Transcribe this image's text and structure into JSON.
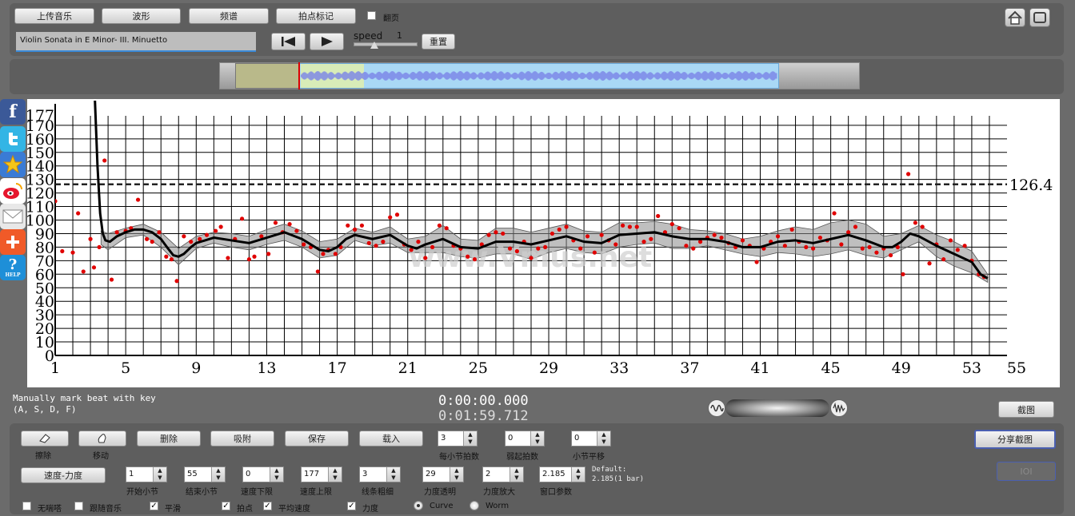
{
  "toolbar": {
    "upload_label": "上传音乐",
    "waveform_label": "波形",
    "spectrum_label": "频谱",
    "beat_mark_label": "拍点标记",
    "page_flip_label": "翻页",
    "page_flip_checked": false
  },
  "track": {
    "title": "Violin Sonata in E Minor- III. Minuetto",
    "speed_label": "speed",
    "speed_value": "1",
    "reset_label": "重置"
  },
  "social": {
    "facebook": "f",
    "help": "HELP"
  },
  "chart_data": {
    "type": "scatter",
    "xlim": [
      1,
      55
    ],
    "ylim": [
      0,
      177
    ],
    "xticks": [
      "1",
      "5",
      "9",
      "13",
      "17",
      "21",
      "25",
      "29",
      "33",
      "37",
      "41",
      "45",
      "49",
      "53",
      "55"
    ],
    "yticks": [
      "0",
      "10",
      "20",
      "30",
      "40",
      "50",
      "60",
      "70",
      "80",
      "90",
      "100",
      "110",
      "120",
      "130",
      "140",
      "150",
      "160",
      "170",
      "177"
    ],
    "average_label": "126.4",
    "average_value": 126.4,
    "watermark": "www.Vmus.net",
    "curve": [
      [
        3.25,
        190
      ],
      [
        3.4,
        140
      ],
      [
        3.55,
        105
      ],
      [
        3.7,
        90
      ],
      [
        3.85,
        85
      ],
      [
        4.1,
        84
      ],
      [
        4.5,
        88
      ],
      [
        5,
        91
      ],
      [
        5.5,
        93
      ],
      [
        6,
        93
      ],
      [
        6.5,
        91
      ],
      [
        7,
        86
      ],
      [
        7.4,
        79
      ],
      [
        7.7,
        74
      ],
      [
        8,
        73
      ],
      [
        8.3,
        75
      ],
      [
        8.7,
        80
      ],
      [
        9,
        83
      ],
      [
        10,
        87
      ],
      [
        11,
        85
      ],
      [
        12,
        83
      ],
      [
        13,
        87
      ],
      [
        14,
        91
      ],
      [
        15,
        86
      ],
      [
        16,
        78
      ],
      [
        16.5,
        77
      ],
      [
        17,
        80
      ],
      [
        17.5,
        86
      ],
      [
        18,
        89
      ],
      [
        19,
        86
      ],
      [
        20,
        89
      ],
      [
        21,
        81
      ],
      [
        21.5,
        79
      ],
      [
        22,
        82
      ],
      [
        23,
        86
      ],
      [
        24,
        80
      ],
      [
        25,
        79
      ],
      [
        26,
        84
      ],
      [
        27,
        84
      ],
      [
        28,
        82
      ],
      [
        29,
        85
      ],
      [
        30,
        88
      ],
      [
        31,
        84
      ],
      [
        32,
        83
      ],
      [
        33,
        89
      ],
      [
        34,
        90
      ],
      [
        35,
        91
      ],
      [
        36,
        88
      ],
      [
        37,
        86
      ],
      [
        38,
        86
      ],
      [
        39,
        84
      ],
      [
        40,
        80
      ],
      [
        41,
        80
      ],
      [
        42,
        84
      ],
      [
        43,
        85
      ],
      [
        44,
        83
      ],
      [
        45,
        86
      ],
      [
        46,
        89
      ],
      [
        47,
        85
      ],
      [
        48,
        80
      ],
      [
        48.5,
        80
      ],
      [
        49,
        84
      ],
      [
        49.5,
        90
      ],
      [
        50,
        88
      ],
      [
        51,
        81
      ],
      [
        52,
        75
      ],
      [
        53,
        69
      ],
      [
        53.5,
        60
      ],
      [
        53.9,
        57
      ]
    ],
    "band": [
      [
        3.6,
        92,
        82
      ],
      [
        4,
        90,
        78
      ],
      [
        5,
        94,
        87
      ],
      [
        6,
        97,
        89
      ],
      [
        7,
        91,
        80
      ],
      [
        8,
        79,
        67
      ],
      [
        9,
        88,
        79
      ],
      [
        10,
        91,
        83
      ],
      [
        11,
        90,
        80
      ],
      [
        12,
        88,
        78
      ],
      [
        13,
        93,
        82
      ],
      [
        14,
        97,
        85
      ],
      [
        15,
        92,
        80
      ],
      [
        16,
        84,
        72
      ],
      [
        17,
        86,
        74
      ],
      [
        18,
        94,
        85
      ],
      [
        19,
        91,
        81
      ],
      [
        20,
        95,
        83
      ],
      [
        21,
        86,
        76
      ],
      [
        22,
        88,
        76
      ],
      [
        23,
        96,
        76
      ],
      [
        24,
        86,
        73
      ],
      [
        25,
        85,
        72
      ],
      [
        26,
        94,
        75
      ],
      [
        27,
        94,
        75
      ],
      [
        28,
        91,
        71
      ],
      [
        29,
        94,
        76
      ],
      [
        30,
        97,
        79
      ],
      [
        31,
        92,
        76
      ],
      [
        32,
        91,
        75
      ],
      [
        33,
        98,
        80
      ],
      [
        34,
        98,
        82
      ],
      [
        35,
        99,
        83
      ],
      [
        36,
        97,
        79
      ],
      [
        37,
        93,
        79
      ],
      [
        38,
        92,
        81
      ],
      [
        39,
        90,
        78
      ],
      [
        40,
        86,
        75
      ],
      [
        41,
        88,
        73
      ],
      [
        42,
        92,
        76
      ],
      [
        43,
        95,
        75
      ],
      [
        44,
        93,
        73
      ],
      [
        45,
        98,
        75
      ],
      [
        46,
        100,
        78
      ],
      [
        47,
        97,
        74
      ],
      [
        48,
        88,
        72
      ],
      [
        49,
        90,
        78
      ],
      [
        50,
        96,
        84
      ],
      [
        51,
        89,
        73
      ],
      [
        52,
        84,
        66
      ],
      [
        53,
        77,
        61
      ],
      [
        53.9,
        60,
        54
      ]
    ],
    "points": [
      [
        1,
        114
      ],
      [
        1.4,
        77
      ],
      [
        2,
        76
      ],
      [
        2.3,
        105
      ],
      [
        2.6,
        62
      ],
      [
        3,
        86
      ],
      [
        3.2,
        65
      ],
      [
        3.5,
        80
      ],
      [
        3.8,
        144
      ],
      [
        4.2,
        56
      ],
      [
        4.5,
        91
      ],
      [
        5,
        92
      ],
      [
        5.3,
        94
      ],
      [
        5.7,
        115
      ],
      [
        6.2,
        86
      ],
      [
        6.5,
        84
      ],
      [
        6.9,
        91
      ],
      [
        7.3,
        73
      ],
      [
        7.6,
        71
      ],
      [
        7.9,
        55
      ],
      [
        8.3,
        88
      ],
      [
        8.7,
        84
      ],
      [
        9.2,
        86
      ],
      [
        9.6,
        89
      ],
      [
        10.1,
        92
      ],
      [
        10.4,
        95
      ],
      [
        10.8,
        72
      ],
      [
        11.2,
        86
      ],
      [
        11.6,
        101
      ],
      [
        12,
        71
      ],
      [
        12.3,
        73
      ],
      [
        12.7,
        88
      ],
      [
        13.1,
        75
      ],
      [
        13.5,
        98
      ],
      [
        13.9,
        91
      ],
      [
        14.3,
        97
      ],
      [
        14.7,
        92
      ],
      [
        15.1,
        82
      ],
      [
        15.5,
        80
      ],
      [
        15.9,
        62
      ],
      [
        16.2,
        75
      ],
      [
        16.5,
        78
      ],
      [
        16.9,
        75
      ],
      [
        17.2,
        80
      ],
      [
        17.6,
        96
      ],
      [
        18,
        93
      ],
      [
        18.4,
        96
      ],
      [
        18.8,
        83
      ],
      [
        19.2,
        81
      ],
      [
        19.6,
        84
      ],
      [
        20,
        102
      ],
      [
        20.4,
        104
      ],
      [
        20.8,
        82
      ],
      [
        21.2,
        78
      ],
      [
        21.6,
        84
      ],
      [
        22,
        72
      ],
      [
        22.4,
        80
      ],
      [
        22.8,
        96
      ],
      [
        23.2,
        94
      ],
      [
        23.6,
        81
      ],
      [
        24,
        79
      ],
      [
        24.4,
        73
      ],
      [
        24.8,
        71
      ],
      [
        25.2,
        82
      ],
      [
        25.6,
        89
      ],
      [
        26,
        91
      ],
      [
        26.4,
        90
      ],
      [
        26.8,
        79
      ],
      [
        27.2,
        77
      ],
      [
        27.6,
        84
      ],
      [
        28,
        72
      ],
      [
        28.4,
        79
      ],
      [
        28.8,
        80
      ],
      [
        29.2,
        90
      ],
      [
        29.6,
        93
      ],
      [
        30,
        95
      ],
      [
        30.4,
        85
      ],
      [
        30.8,
        79
      ],
      [
        31.2,
        88
      ],
      [
        31.6,
        76
      ],
      [
        32,
        89
      ],
      [
        32.4,
        85
      ],
      [
        32.8,
        82
      ],
      [
        33.2,
        96
      ],
      [
        33.6,
        95
      ],
      [
        34,
        95
      ],
      [
        34.4,
        84
      ],
      [
        34.8,
        86
      ],
      [
        35.2,
        103
      ],
      [
        35.6,
        91
      ],
      [
        36,
        97
      ],
      [
        36.4,
        94
      ],
      [
        36.8,
        81
      ],
      [
        37.2,
        79
      ],
      [
        37.6,
        84
      ],
      [
        38,
        87
      ],
      [
        38.4,
        89
      ],
      [
        38.8,
        87
      ],
      [
        39.2,
        83
      ],
      [
        39.6,
        80
      ],
      [
        40,
        85
      ],
      [
        40.4,
        81
      ],
      [
        40.8,
        69
      ],
      [
        41.2,
        79
      ],
      [
        41.6,
        84
      ],
      [
        42,
        88
      ],
      [
        42.4,
        81
      ],
      [
        42.8,
        93
      ],
      [
        43.2,
        84
      ],
      [
        43.6,
        80
      ],
      [
        44,
        79
      ],
      [
        44.4,
        87
      ],
      [
        44.8,
        85
      ],
      [
        45.2,
        105
      ],
      [
        45.6,
        82
      ],
      [
        46,
        91
      ],
      [
        46.4,
        95
      ],
      [
        46.8,
        79
      ],
      [
        47.2,
        80
      ],
      [
        47.6,
        76
      ],
      [
        48,
        79
      ],
      [
        48.4,
        74
      ],
      [
        48.8,
        80
      ],
      [
        49.1,
        60
      ],
      [
        49.4,
        134
      ],
      [
        49.8,
        98
      ],
      [
        50.2,
        95
      ],
      [
        50.6,
        68
      ],
      [
        51,
        82
      ],
      [
        51.4,
        71
      ],
      [
        51.8,
        85
      ],
      [
        52.2,
        78
      ],
      [
        52.6,
        81
      ],
      [
        53,
        70
      ],
      [
        53.4,
        60
      ],
      [
        53.7,
        58
      ]
    ]
  },
  "status": {
    "hint_line1": "Manually mark beat with key",
    "hint_line2": "(A, S, D, F)",
    "time_current": "0:00:00.000",
    "time_total": "0:01:59.712",
    "screenshot_label": "截图"
  },
  "controls": {
    "erase_label": "擦除",
    "move_label": "移动",
    "delete_label": "删除",
    "snap_label": "吸附",
    "save_label": "保存",
    "load_label": "载入",
    "tempo_dynamics_label": "速度-力度",
    "share_label": "分享截图",
    "disabled_button_label": "IOI",
    "beats_per_bar": {
      "value": "3",
      "label": "每小节拍数"
    },
    "pickup_beats": {
      "value": "0",
      "label": "弱起拍数"
    },
    "bar_offset": {
      "value": "0",
      "label": "小节平移"
    },
    "start_bar": {
      "value": "1",
      "label": "开始小节"
    },
    "end_bar": {
      "value": "55",
      "label": "结束小节"
    },
    "tempo_min": {
      "value": "0",
      "label": "速度下限"
    },
    "tempo_max": {
      "value": "177",
      "label": "速度上限"
    },
    "line_width": {
      "value": "3",
      "label": "线条粗细"
    },
    "dynamics_opacity": {
      "value": "29",
      "label": "力度透明"
    },
    "dynamics_scale": {
      "value": "2",
      "label": "力度放大"
    },
    "window_param": {
      "value": "2.185",
      "label": "窗口参数"
    },
    "default_line1": "Default:",
    "default_line2": "2.185(1 bar)",
    "checkboxes": {
      "no_gap": {
        "label": "无喘嗒",
        "checked": false
      },
      "follow_music": {
        "label": "跟随音乐",
        "checked": false
      },
      "smooth": {
        "label": "平滑",
        "checked": true
      },
      "beat_point": {
        "label": "拍点",
        "checked": true
      },
      "avg_tempo": {
        "label": "平均速度",
        "checked": true
      },
      "dynamics": {
        "label": "力度",
        "checked": true
      }
    },
    "curve_label": "Curve",
    "worm_label": "Worm"
  }
}
